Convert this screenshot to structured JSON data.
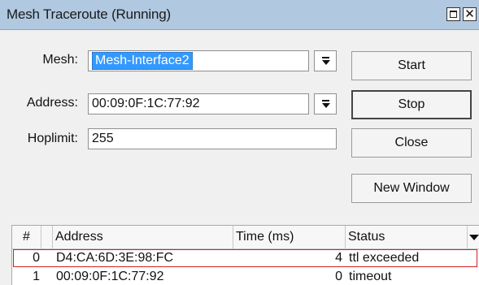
{
  "window": {
    "title": "Mesh Traceroute (Running)",
    "close_glyph": "✕"
  },
  "form": {
    "mesh": {
      "label": "Mesh:",
      "value": "Mesh-Interface2"
    },
    "address": {
      "label": "Address:",
      "value": "00:09:0F:1C:77:92"
    },
    "hoplimit": {
      "label": "Hoplimit:",
      "value": "255"
    }
  },
  "buttons": {
    "start": "Start",
    "stop": "Stop",
    "close": "Close",
    "new_window": "New Window"
  },
  "table": {
    "columns": [
      "#",
      "Address",
      "Time (ms)",
      "Status"
    ],
    "rows": [
      {
        "num": "0",
        "address": "D4:CA:6D:3E:98:FC",
        "time": "4",
        "status": "ttl exceeded"
      },
      {
        "num": "1",
        "address": "00:09:0F:1C:77:92",
        "time": "0",
        "status": "timeout"
      }
    ]
  },
  "colors": {
    "titlebar": "#b0c8e0",
    "selection": "#3399ff",
    "row_highlight_border": "#d42020"
  },
  "icons": [
    "maximize-icon",
    "close-icon",
    "dropdown-icon",
    "column-menu-icon"
  ]
}
